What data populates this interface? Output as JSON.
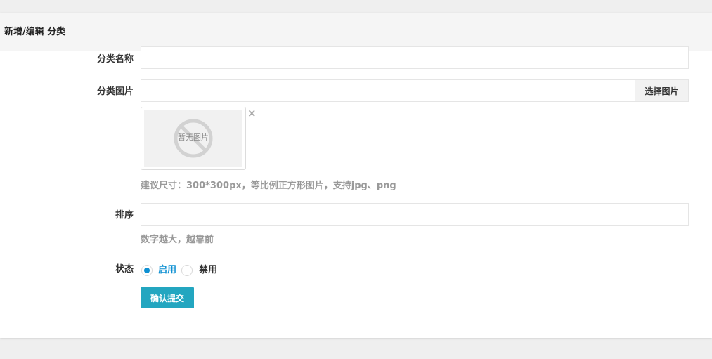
{
  "panel": {
    "title": "新增/编辑 分类"
  },
  "form": {
    "name": {
      "label": "分类名称",
      "value": ""
    },
    "image": {
      "label": "分类图片",
      "value": "",
      "choose_label": "选择图片",
      "placeholder_text": "暂无图片",
      "remove_icon": "close-icon",
      "help": "建议尺寸：300*300px，等比例正方形图片，支持jpg、png"
    },
    "sort": {
      "label": "排序",
      "value": "",
      "help": "数字越大，越靠前"
    },
    "status": {
      "label": "状态",
      "options": [
        {
          "label": "启用",
          "checked": true,
          "color": "#0e90d2"
        },
        {
          "label": "禁用",
          "checked": false,
          "color": "#333333"
        }
      ]
    },
    "submit_label": "确认提交"
  },
  "colors": {
    "accent": "#23a6c0",
    "radio_checked": "#0e90d2",
    "page_background": "#efefef",
    "header_background": "#f5f5f5"
  }
}
